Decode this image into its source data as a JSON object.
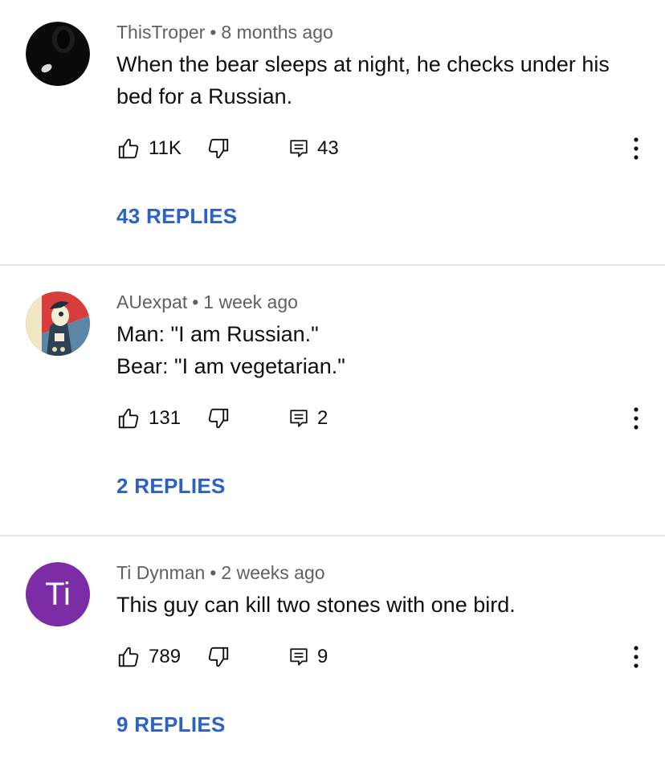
{
  "comments": [
    {
      "author": "ThisTroper",
      "separator": "•",
      "time": "8 months ago",
      "lines": [
        "When the bear sleeps at night, he checks under his",
        "bed for a Russian."
      ],
      "likes": "11K",
      "reply_count": "43",
      "replies_label": "43 REPLIES",
      "avatar_icon": "dark-sphere-avatar"
    },
    {
      "author": "AUexpat",
      "separator": "•",
      "time": "1 week ago",
      "lines": [
        "Man: \"I am Russian.\"",
        "Bear: \"I am vegetarian.\""
      ],
      "likes": "131",
      "reply_count": "2",
      "replies_label": "2 REPLIES",
      "avatar_icon": "poster-style-avatar"
    },
    {
      "author": "Ti Dynman",
      "separator": "•",
      "time": "2 weeks ago",
      "lines": [
        "This guy can kill two stones with one bird."
      ],
      "likes": "789",
      "reply_count": "9",
      "replies_label": "9 REPLIES",
      "avatar_initials": "Ti",
      "avatar_color": "#7b2ca6"
    }
  ],
  "icons": {
    "like": "thumb-up-icon",
    "dislike": "thumb-down-icon",
    "reply": "reply-comment-icon",
    "more": "more-vertical-icon"
  },
  "colors": {
    "link": "#2a62c8",
    "meta": "#606060",
    "divider": "#e5e5e5"
  }
}
